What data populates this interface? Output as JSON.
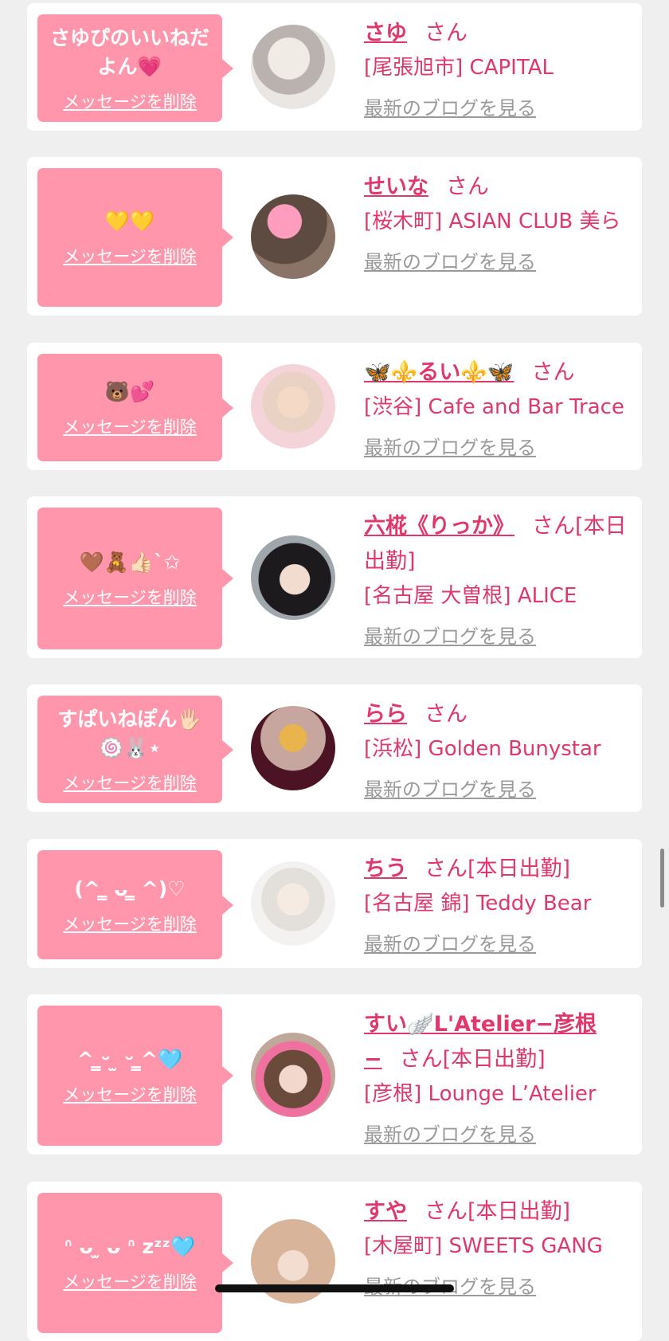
{
  "colors": {
    "bubble": "#ff96ab",
    "name": "#e0386b",
    "link_gray": "#9a9a9a",
    "background": "#efefef"
  },
  "cards": [
    {
      "message": "さゆぴのいいねだよん💗",
      "delete_label": "メッセージを削除",
      "name": "さゆ",
      "honorific": "さん",
      "status": "",
      "shop": "[尾張旭市] CAPITAL",
      "blog_label": "最新のブログを見る"
    },
    {
      "message": "💛💛",
      "delete_label": "メッセージを削除",
      "name": "せいな",
      "honorific": "さん",
      "status": "",
      "shop": "[桜木町] ASIAN CLUB 美ら",
      "blog_label": "最新のブログを見る"
    },
    {
      "message": "🐻💕",
      "delete_label": "メッセージを削除",
      "name": "🦋⚜️るい⚜️🦋",
      "honorific": "さん",
      "status": "",
      "shop": "[渋谷] Cafe and Bar Trace",
      "blog_label": "最新のブログを見る"
    },
    {
      "message": "🤎🧸👍🏻`✩",
      "delete_label": "メッセージを削除",
      "name": "六椛《りっか》",
      "honorific": "さん",
      "status": "[本日出勤]",
      "shop": "[名古屋 大曽根] ALICE",
      "blog_label": "最新のブログを見る"
    },
    {
      "message": "すぱいねぽん🖐🏻🍥🐰⋆",
      "delete_label": "メッセージを削除",
      "name": "らら",
      "honorific": "さん",
      "status": "",
      "shop": "[浜松] Golden Bunystar",
      "blog_label": "最新のブログを見る"
    },
    {
      "message": "(^ ̳ ᴗ ̳ ^)♡",
      "delete_label": "メッセージを削除",
      "name": "ちう",
      "honorific": "さん",
      "status": "[本日出勤]",
      "shop": "[名古屋 錦] Teddy Bear",
      "blog_label": "最新のブログを見る"
    },
    {
      "message": "^ ̳ᵕ ̫ ᵕ ̳^🩵",
      "delete_label": "メッセージを削除",
      "name": "すい🪽L'Atelier−彦根−",
      "honorific": "さん",
      "status": "[本日出勤]",
      "shop": "[彦根] Lounge L’Atelier",
      "blog_label": "最新のブログを見る"
    },
    {
      "message": "ᐢ ᴗ ̫ ᴗ ᐢ zᶻᶻ🩵",
      "delete_label": "メッセージを削除",
      "name": "すや",
      "honorific": "さん",
      "status": "[本日出勤]",
      "shop": "[木屋町] SWEETS GANG",
      "blog_label": "最新のブログを見る"
    }
  ]
}
